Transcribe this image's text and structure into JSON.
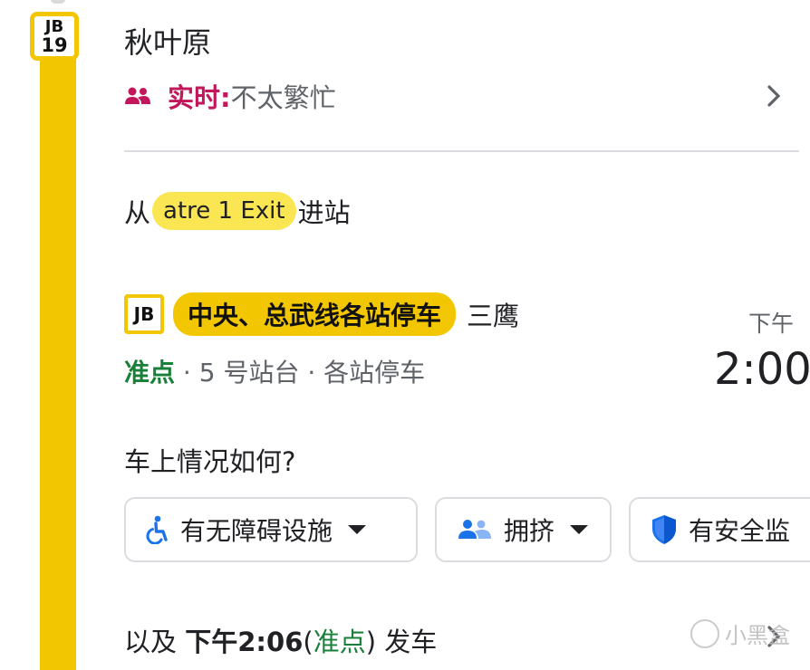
{
  "station": {
    "badge_code": "JB",
    "badge_number": "19",
    "name": "秋叶原",
    "crowd_label": "实时:",
    "crowd_value": "不太繁忙"
  },
  "entry": {
    "prefix": "从",
    "exit_name": "atre 1 Exit",
    "suffix": "进站"
  },
  "train": {
    "line_code": "JB",
    "line_name": "中央、总武线各站停车",
    "destination": "三鹰",
    "status": "准点",
    "details": "· 5 号站台 · 各站停车",
    "time_label": "下午",
    "time": "2:00"
  },
  "feedback": {
    "question": "车上情况如何?",
    "chips": [
      {
        "label": "有无障碍设施",
        "icon": "wheelchair-icon"
      },
      {
        "label": "拥挤",
        "icon": "people-icon"
      },
      {
        "label": "有安全监",
        "icon": "shield-icon"
      }
    ]
  },
  "next_departure": {
    "prefix": "以及",
    "time": "下午2:06",
    "open_paren": "(",
    "status": "准点",
    "close_paren": ")",
    "suffix": "发车"
  },
  "watermark": {
    "text": "小黑盒"
  },
  "colors": {
    "line_yellow": "#f2c600",
    "exit_chip_yellow": "#fae552",
    "realtime_magenta": "#c2185b",
    "ontime_green": "#188038"
  }
}
